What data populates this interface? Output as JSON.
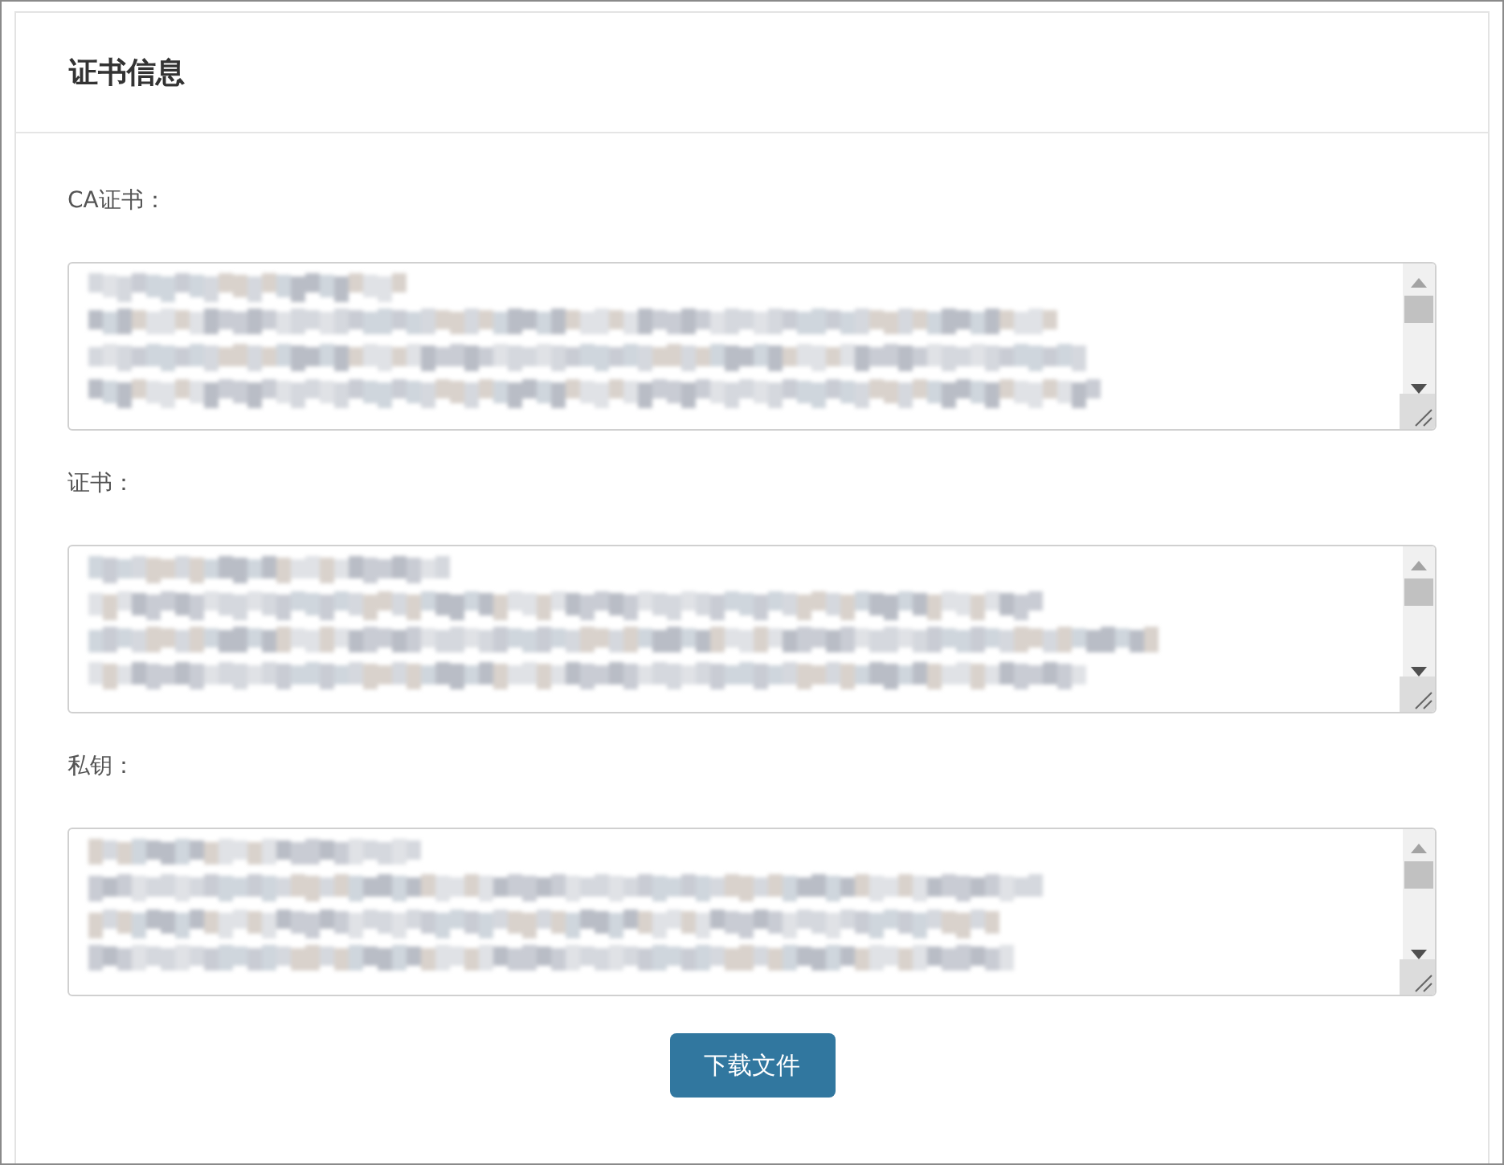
{
  "panel": {
    "title": "证书信息"
  },
  "fields": [
    {
      "label": "CA证书："
    },
    {
      "label": "证书："
    },
    {
      "label": "私钥："
    }
  ],
  "button": {
    "label": "下载文件"
  }
}
